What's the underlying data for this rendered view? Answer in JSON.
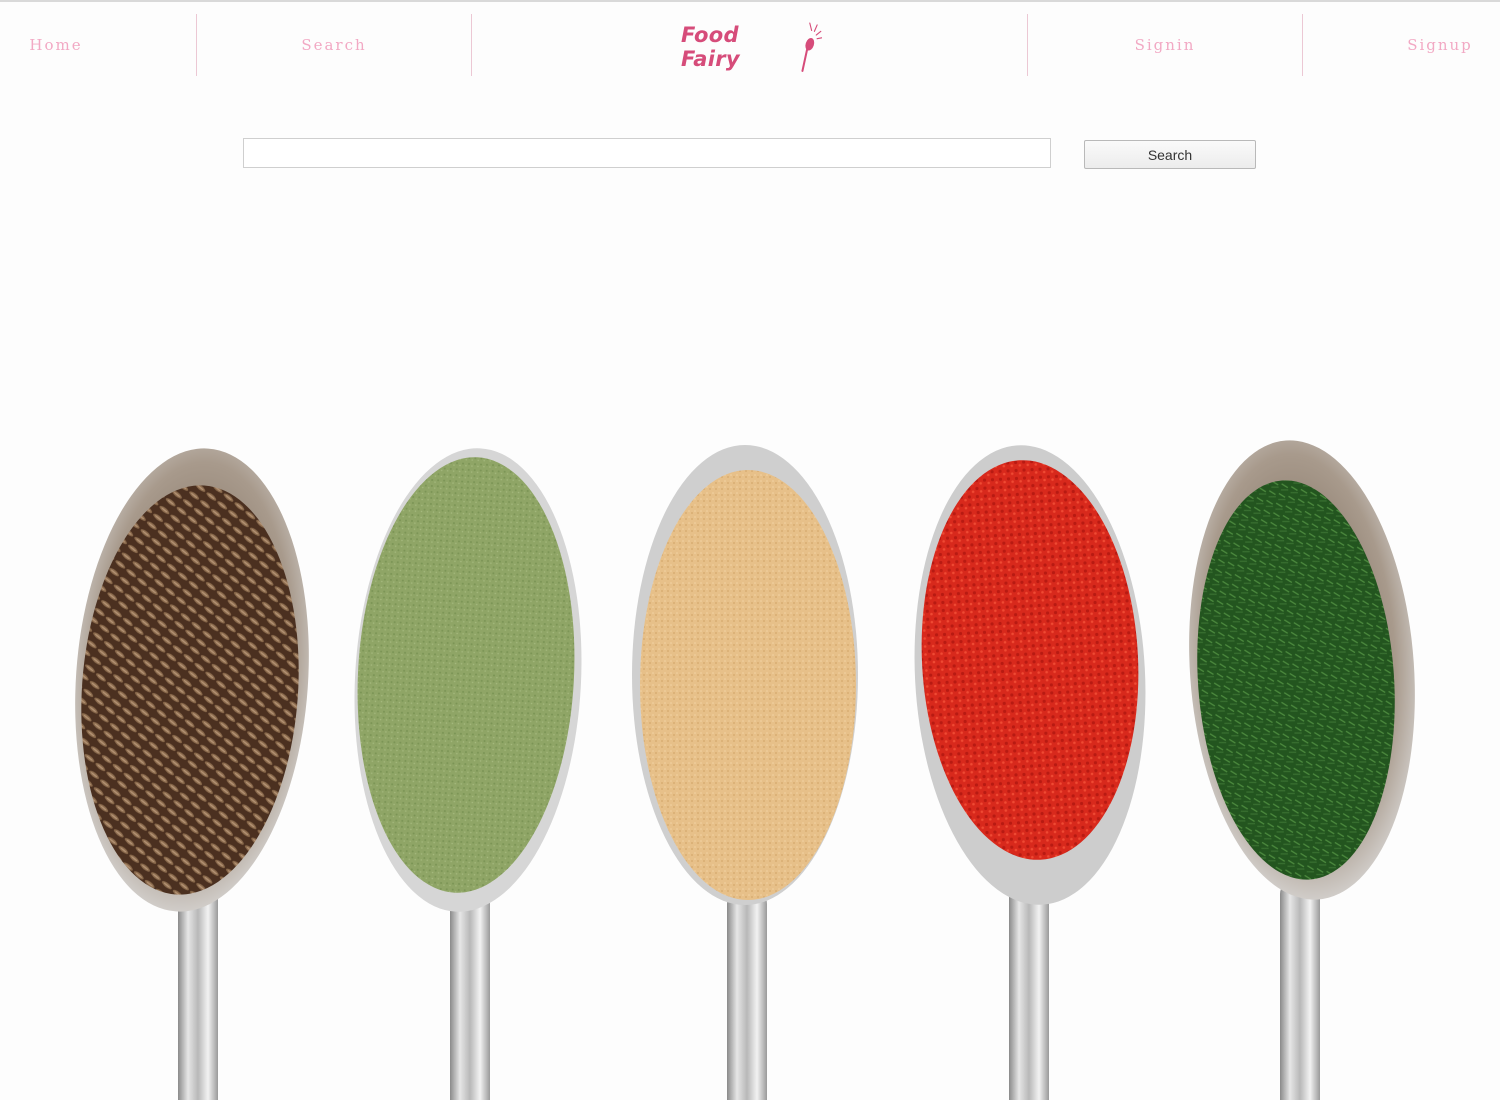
{
  "nav": {
    "home_label": "Home",
    "search_label": "Search",
    "signin_label": "Signin",
    "signup_label": "Signup",
    "link_color": "#f2a9c4"
  },
  "logo": {
    "text": "Food Fairy",
    "icon": "fairy-spoon-icon",
    "color": "#d64c7a"
  },
  "search": {
    "placeholder": "",
    "value": "",
    "button_label": "Search"
  },
  "hero": {
    "subject": "spice-spoons-image",
    "spices": [
      {
        "name": "cumin-seeds",
        "color": "#6e4a30"
      },
      {
        "name": "green-powder",
        "color": "#8fa566"
      },
      {
        "name": "ginger-powder",
        "color": "#e7c089"
      },
      {
        "name": "red-paprika",
        "color": "#d8291c"
      },
      {
        "name": "dried-dill",
        "color": "#2f6a2c"
      }
    ]
  }
}
